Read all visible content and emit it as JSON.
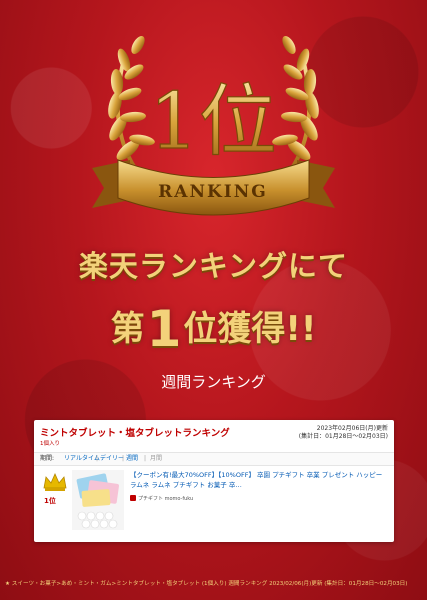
{
  "emblem": {
    "rank_text": "1位",
    "ribbon_text": "RANKING"
  },
  "headline": {
    "line1": "楽天ランキングにて",
    "line2_prefix": "第",
    "line2_number": "1",
    "line2_suffix": "位獲得!!"
  },
  "period_label": "週間ランキング",
  "card": {
    "title": "ミントタブレット・塩タブレットランキング",
    "subtitle": "1個入り",
    "date_line1": "2023年02月06日(月)更新",
    "date_line2": "(集計日：01月28日～02月03日)",
    "tabs": {
      "label": "期間:",
      "items": [
        "リアルタイム",
        "デイリー",
        "週間",
        "月間"
      ],
      "separator": "|"
    },
    "item": {
      "rank": "1位",
      "title": "【クーポン有!最大70%OFF】【10%OFF】 卒園 プチギフト 卒業 プレゼント ハッピーラムネ ラムネ プチギフト お菓子 卒…",
      "shop": "プチギフト momo-fuku"
    }
  },
  "footer": {
    "text": "★ スイーツ・お菓子>あめ・ミント・ガム>ミントタブレット・塩タブレット (1個入り) 週間ランキング 2023/02/06(月)更新 (集計日：01月28日～02月03日)"
  },
  "colors": {
    "background": "#b5161d",
    "gold": "#f3d27a",
    "rakuten_red": "#bf0000",
    "link_blue": "#0058b3"
  }
}
